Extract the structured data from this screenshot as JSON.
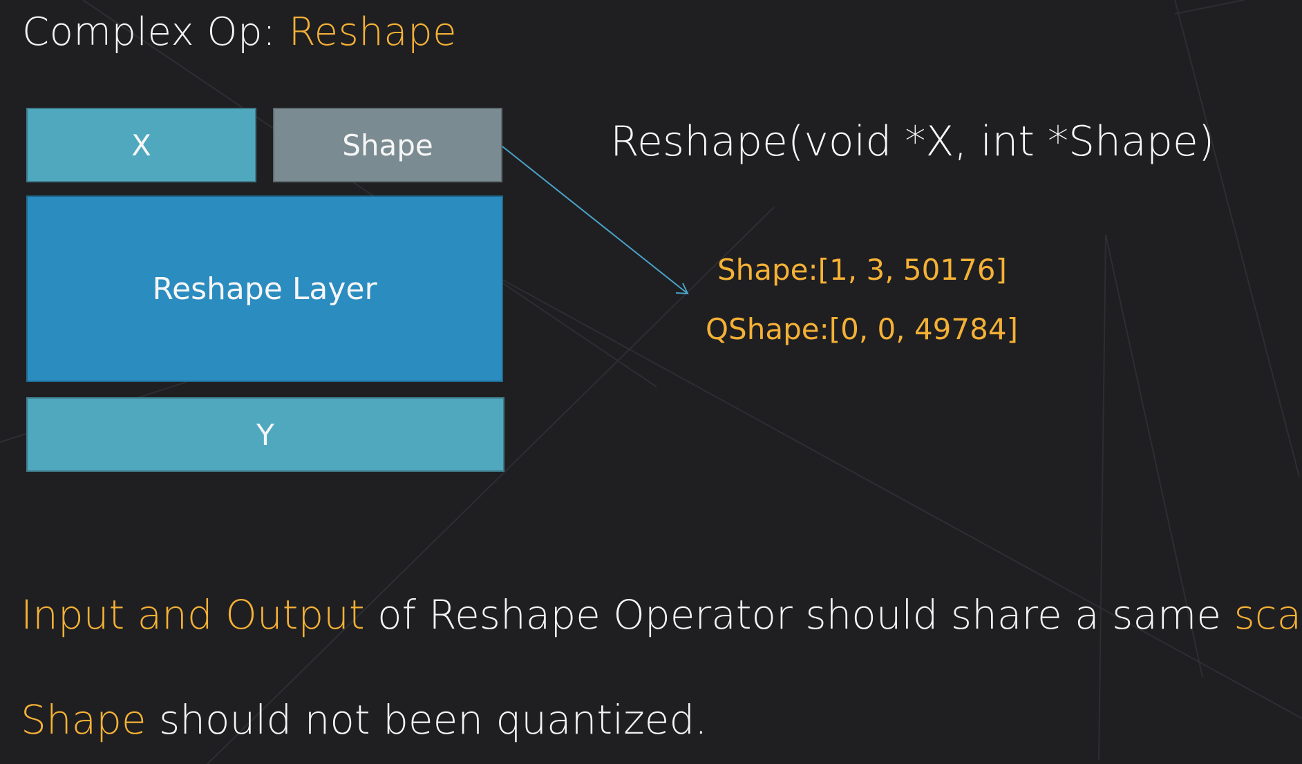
{
  "title": {
    "prefix": "Complex Op: ",
    "highlight": "Reshape"
  },
  "diagram": {
    "input_x_label": "X",
    "input_shape_label": "Shape",
    "layer_label": "Reshape Layer",
    "output_y_label": "Y"
  },
  "signature": "Reshape(void *X, int *Shape)",
  "shape_values": {
    "shape": "Shape:[1, 3, 50176]",
    "qshape": "QShape:[0, 0, 49784]"
  },
  "notes": {
    "line1_highlight_a": "Input and Output",
    "line1_text": " of Reshape Operator should share a same ",
    "line1_highlight_b": "scale.",
    "line2_highlight": "Shape",
    "line2_text": " should not been quantized."
  },
  "colors": {
    "background": "#1f1f22",
    "accent": "#f5b135",
    "box_io": "#4fa8be",
    "box_shape": "#7a8b91",
    "box_layer": "#2b8cbf",
    "arrow": "#4aa3c9"
  }
}
